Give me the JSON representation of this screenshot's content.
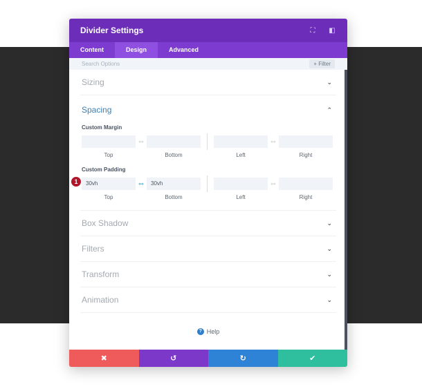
{
  "modal": {
    "title": "Divider Settings",
    "header_icons": [
      "expand-icon",
      "sidebar-toggle-icon"
    ],
    "tabs": [
      {
        "label": "Content",
        "active": false
      },
      {
        "label": "Design",
        "active": true
      },
      {
        "label": "Advanced",
        "active": false
      }
    ],
    "search": {
      "placeholder": "Search Options",
      "filter_label": "+ Filter"
    },
    "sections_top": [
      {
        "label": "Sizing",
        "expanded": false
      }
    ],
    "spacing": {
      "label": "Spacing",
      "expanded": true,
      "margin": {
        "label": "Custom Margin",
        "top": "",
        "bottom": "",
        "left": "",
        "right": ""
      },
      "padding": {
        "label": "Custom Padding",
        "top": "30vh",
        "bottom": "30vh",
        "left": "",
        "right": "",
        "linked_top_bottom": true
      },
      "sublabels": [
        "Top",
        "Bottom",
        "Left",
        "Right"
      ],
      "badge": "1"
    },
    "sections_bottom": [
      {
        "label": "Box Shadow"
      },
      {
        "label": "Filters"
      },
      {
        "label": "Transform"
      },
      {
        "label": "Animation"
      }
    ],
    "help_label": "Help",
    "footer": {
      "cancel": "✖",
      "undo": "↺",
      "redo": "↻",
      "save": "✔",
      "colors": {
        "cancel": "#ef5a5a",
        "undo": "#7b38c9",
        "redo": "#2f83d6",
        "save": "#2fbf9f"
      }
    }
  }
}
